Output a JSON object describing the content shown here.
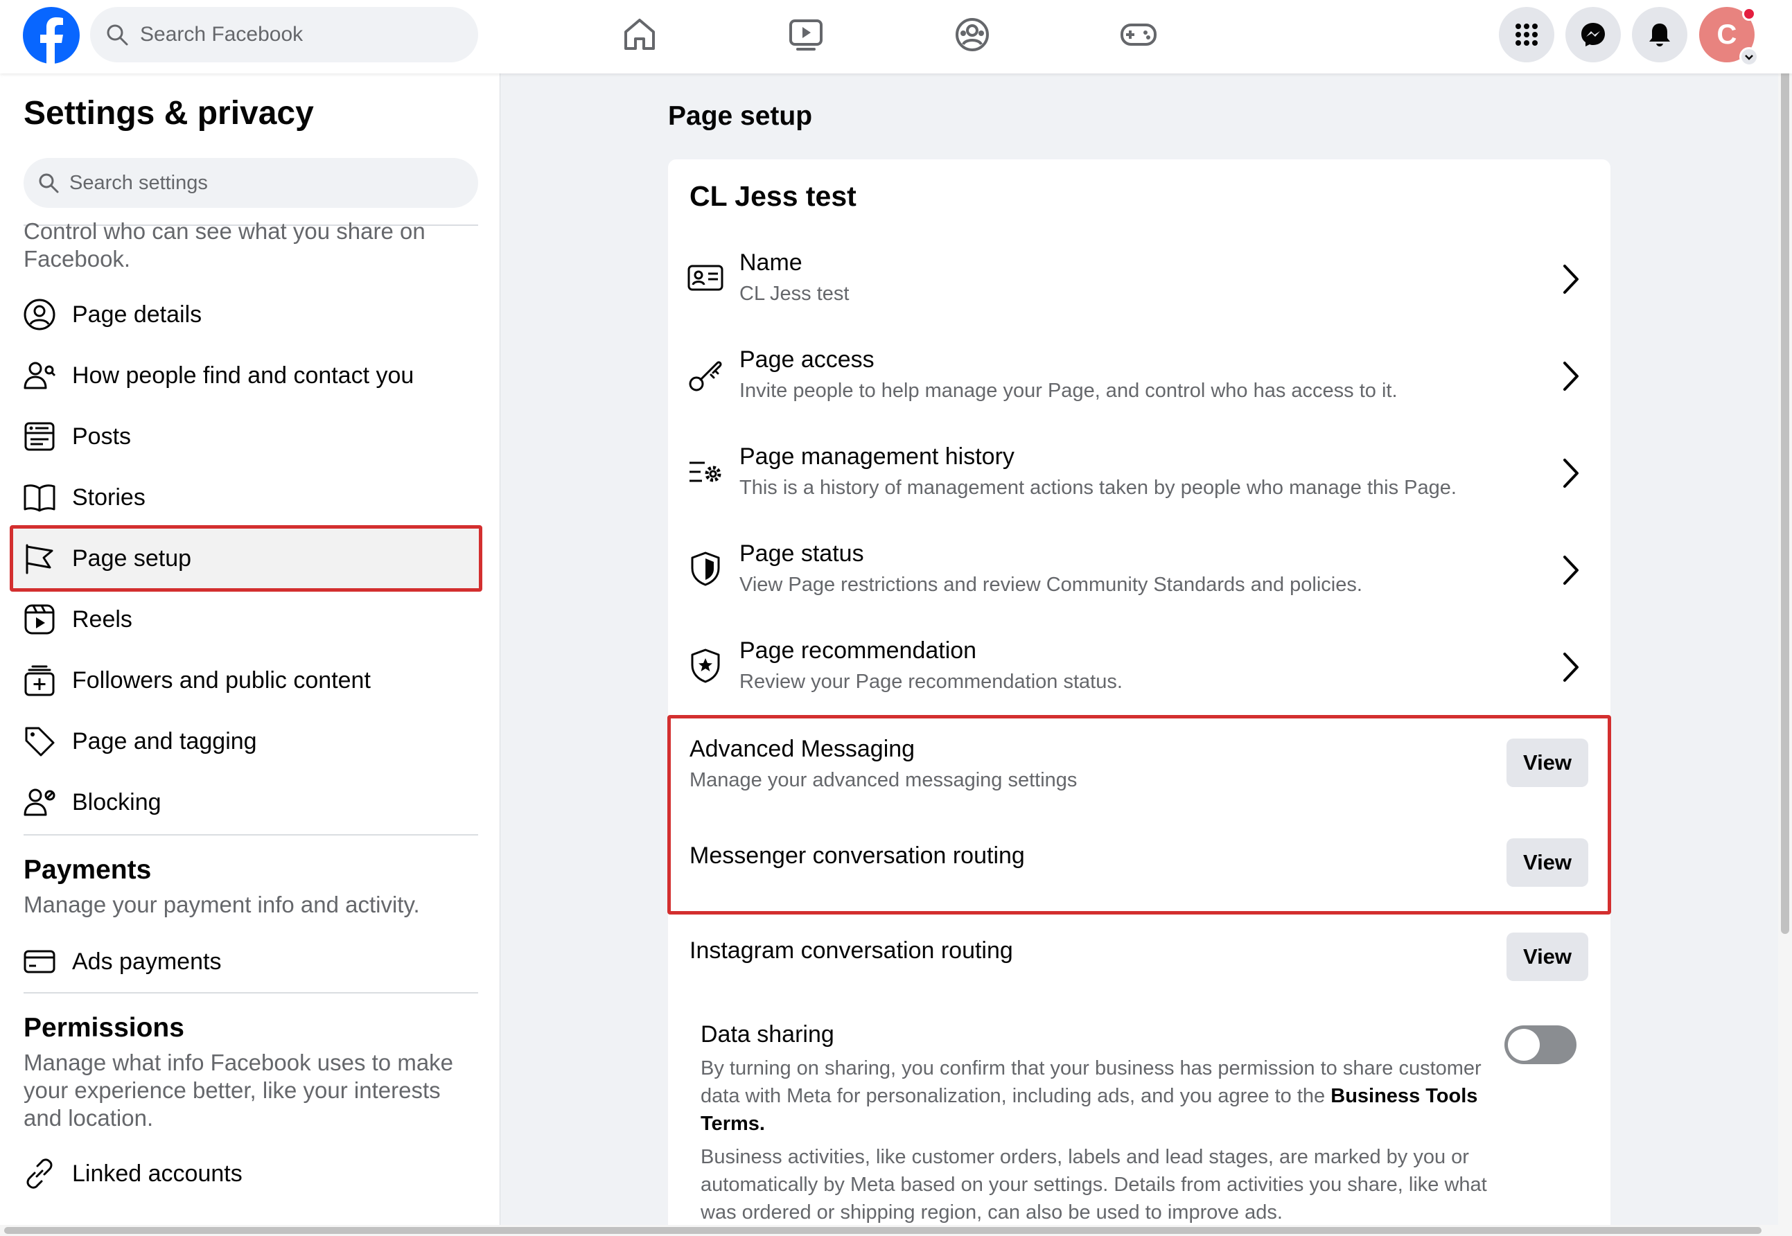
{
  "colors": {
    "brand": "#0866ff",
    "highlight": "#d32f2f",
    "avatar": "#e8837f",
    "text_secondary": "#65676b"
  },
  "topbar": {
    "search_placeholder": "Search Facebook",
    "nav_icons": [
      "home-icon",
      "video-icon",
      "groups-icon",
      "gaming-icon"
    ],
    "right_icons": [
      "menu-grid-icon",
      "messenger-icon",
      "notifications-icon"
    ],
    "avatar_letter": "C"
  },
  "sidebar": {
    "title": "Settings & privacy",
    "search_placeholder": "Search settings",
    "intro_text": "Control who can see what you share on Facebook.",
    "items": [
      {
        "label": "Page details",
        "icon": "user-circle-icon"
      },
      {
        "label": "How people find and contact you",
        "icon": "people-search-icon"
      },
      {
        "label": "Posts",
        "icon": "posts-icon"
      },
      {
        "label": "Stories",
        "icon": "book-icon"
      },
      {
        "label": "Page setup",
        "icon": "flag-icon"
      },
      {
        "label": "Reels",
        "icon": "reels-icon"
      },
      {
        "label": "Followers and public content",
        "icon": "followers-icon"
      },
      {
        "label": "Page and tagging",
        "icon": "tag-icon"
      },
      {
        "label": "Blocking",
        "icon": "block-user-icon"
      }
    ],
    "payments": {
      "title": "Payments",
      "desc": "Manage your payment info and activity.",
      "items": [
        {
          "label": "Ads payments",
          "icon": "card-icon"
        }
      ]
    },
    "permissions": {
      "title": "Permissions",
      "desc": "Manage what info Facebook uses to make your experience better, like your interests and location.",
      "items": [
        {
          "label": "Linked accounts",
          "icon": "link-icon"
        }
      ]
    }
  },
  "main": {
    "title": "Page setup",
    "card_title": "CL Jess test",
    "rows": [
      {
        "title": "Name",
        "sub": "CL Jess test",
        "icon": "id-card-icon"
      },
      {
        "title": "Page access",
        "sub": "Invite people to help manage your Page, and control who has access to it.",
        "icon": "key-icon"
      },
      {
        "title": "Page management history",
        "sub": "This is a history of management actions taken by people who manage this Page.",
        "icon": "history-gear-icon"
      },
      {
        "title": "Page status",
        "sub": "View Page restrictions and review Community Standards and policies.",
        "icon": "shield-icon"
      },
      {
        "title": "Page recommendation",
        "sub": "Review your Page recommendation status.",
        "icon": "shield-star-icon"
      }
    ],
    "view_rows": [
      {
        "title": "Advanced Messaging",
        "sub": "Manage your advanced messaging settings",
        "button": "View"
      },
      {
        "title": "Messenger conversation routing",
        "sub": "",
        "button": "View"
      },
      {
        "title": "Instagram conversation routing",
        "sub": "",
        "button": "View"
      }
    ],
    "data_sharing": {
      "title": "Data sharing",
      "text1": "By turning on sharing, you confirm that your business has permission to share customer data with Meta for personalization, including ads, and you agree to the",
      "terms": "Business Tools Terms.",
      "text2": "Business activities, like customer orders, labels and lead stages, are marked by you or automatically by Meta based on your settings. Details from activities you share, like what was ordered or shipping region, can also be used to improve ads.",
      "enabled": false
    }
  }
}
